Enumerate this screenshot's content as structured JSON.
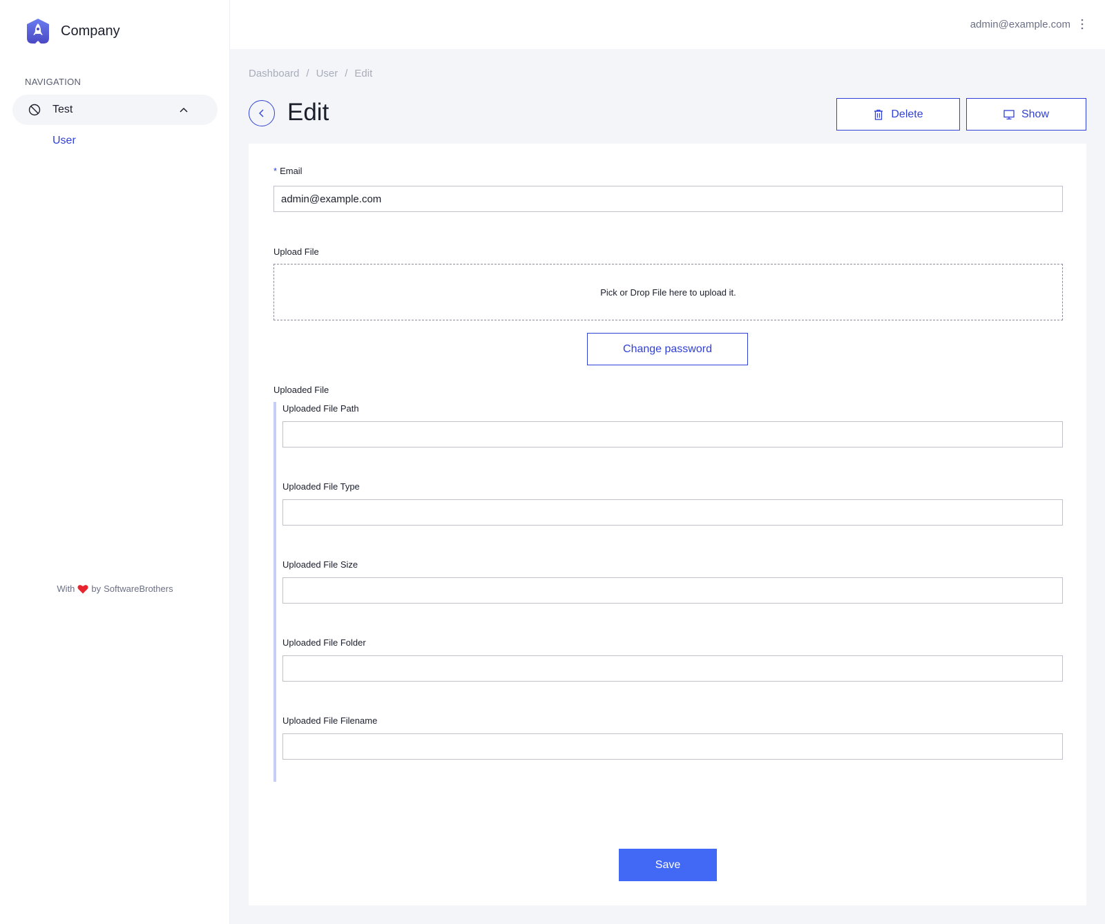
{
  "brand": {
    "name": "Company",
    "logo_icon": "rocket-icon"
  },
  "sidebar": {
    "heading": "NAVIGATION",
    "group": {
      "label": "Test",
      "icon": "ban-icon",
      "expanded": true
    },
    "items": [
      {
        "label": "User"
      }
    ],
    "footer": {
      "prefix": "With",
      "suffix": "by",
      "author": "SoftwareBrothers"
    }
  },
  "topbar": {
    "user_email": "admin@example.com"
  },
  "breadcrumb": [
    "Dashboard",
    "User",
    "Edit"
  ],
  "breadcrumb_separator": "/",
  "page": {
    "title": "Edit",
    "delete_label": "Delete",
    "show_label": "Show"
  },
  "form": {
    "email": {
      "label": "Email",
      "required_mark": "*",
      "value": "admin@example.com"
    },
    "upload": {
      "label": "Upload File",
      "dropzone_text": "Pick or Drop File here to upload it."
    },
    "change_password_label": "Change password",
    "uploaded_file": {
      "label": "Uploaded File",
      "fields": [
        {
          "label": "Uploaded File Path",
          "value": ""
        },
        {
          "label": "Uploaded File Type",
          "value": ""
        },
        {
          "label": "Uploaded File Size",
          "value": ""
        },
        {
          "label": "Uploaded File Folder",
          "value": ""
        },
        {
          "label": "Uploaded File Filename",
          "value": ""
        }
      ]
    },
    "save_label": "Save"
  },
  "colors": {
    "primary": "#3040d6",
    "save_button": "#4268f6",
    "background": "#f4f5f9",
    "heart": "#e8252e"
  }
}
